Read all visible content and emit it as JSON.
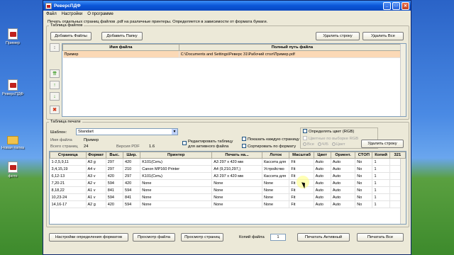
{
  "desktop": {
    "icons": [
      {
        "label": "Пример",
        "type": "pdf"
      },
      {
        "label": "РеверсПДФ",
        "type": "pdf"
      },
      {
        "label": "Новая папка",
        "type": "folder"
      },
      {
        "label": "фото",
        "type": "pdf"
      }
    ]
  },
  "window": {
    "title": "РеверсПДФ",
    "menu": [
      "Файл",
      "Настройки",
      "О программе"
    ],
    "description": "Печать отдельных страниц файлов .pdf на различные принтеры. Определяется в зависимости от формата бумаги."
  },
  "files": {
    "legend": "Таблица файлов",
    "add_files": "Добавить Файлы",
    "add_folder": "Добавить Папку",
    "delete_row": "Удалить строку",
    "delete_all": "Удалить Все",
    "columns": [
      "Имя файла",
      "Полный путь файла"
    ],
    "rows": [
      {
        "name": "Пример",
        "path": "C:\\Documents and Settings\\Реверс 31\\Рабочий стол\\Пример.pdf"
      }
    ]
  },
  "print": {
    "legend": "Таблица печати",
    "template_label": "Шаблон:",
    "template_value": "Standart",
    "file_name_label": "Имя файла",
    "file_name_value": "Пример",
    "pages_label": "Всего страниц",
    "pages_value": "24",
    "pdf_version_label": "Версия PDF",
    "pdf_version_value": "1.6",
    "edit_table": "Редактировать таблицу для активного файла",
    "show_each_page": "Показать каждую страницу",
    "sort_by_format": "Сортировать по формату",
    "detect_color": "Определять цвет (RGB)",
    "color_by_rgb": "Цветные по выборке RGB",
    "radio_all": "Все",
    "radio_bw": "Ч/Б",
    "radio_color": "Цвет",
    "delete_row": "Удалить строку",
    "columns": [
      "Страница",
      "Формат",
      "Выс.",
      "Шир.",
      "Принтер",
      "Печать на...",
      "Лоток",
      "Масштаб",
      "Цвет",
      "Ориент.",
      "СТОП",
      "Копий",
      "321"
    ],
    "rows": [
      [
        "1-2,5,9,11",
        "A3 g",
        "297",
        "420",
        "K101(Сеть)",
        "A3 297 x 420 мм",
        "Кассета для",
        "Fit",
        "Auto",
        "Auto",
        "No",
        "1",
        ""
      ],
      [
        "3,4,15,19",
        "A4 v",
        "297",
        "210",
        "Canon MP160 Printer",
        "A4 (9,210,297,)",
        "Устройство",
        "Fit",
        "Auto",
        "Auto",
        "No",
        "1",
        ""
      ],
      [
        "6,12-13",
        "A3 v",
        "420",
        "297",
        "K101(Сеть)",
        "A3 297 x 420 мм",
        "Кассета для",
        "Fit",
        "Auto",
        "Auto",
        "No",
        "1",
        ""
      ],
      [
        "7,20-21",
        "A2 v",
        "594",
        "420",
        "None",
        "None",
        "None",
        "Fit",
        "Auto",
        "Auto",
        "No",
        "1",
        ""
      ],
      [
        "8,18,22",
        "A1 v",
        "841",
        "594",
        "None",
        "None",
        "None",
        "Fit",
        "Auto",
        "Auto",
        "No",
        "1",
        ""
      ],
      [
        "10,23-24",
        "A1 v",
        "594",
        "841",
        "None",
        "None",
        "None",
        "Fit",
        "Auto",
        "Auto",
        "No",
        "1",
        ""
      ],
      [
        "14,16-17",
        "A2 g",
        "420",
        "594",
        "None",
        "None",
        "None",
        "Fit",
        "Auto",
        "Auto",
        "No",
        "1",
        ""
      ]
    ]
  },
  "footer": {
    "format_settings": "Настройки определения форматов",
    "view_file": "Просмотр файла",
    "view_pages": "Просмотр страниц",
    "copies_label": "Копий файла",
    "copies_value": "1",
    "print_active": "Печатать Активный",
    "print_all": "Печатать Все"
  }
}
